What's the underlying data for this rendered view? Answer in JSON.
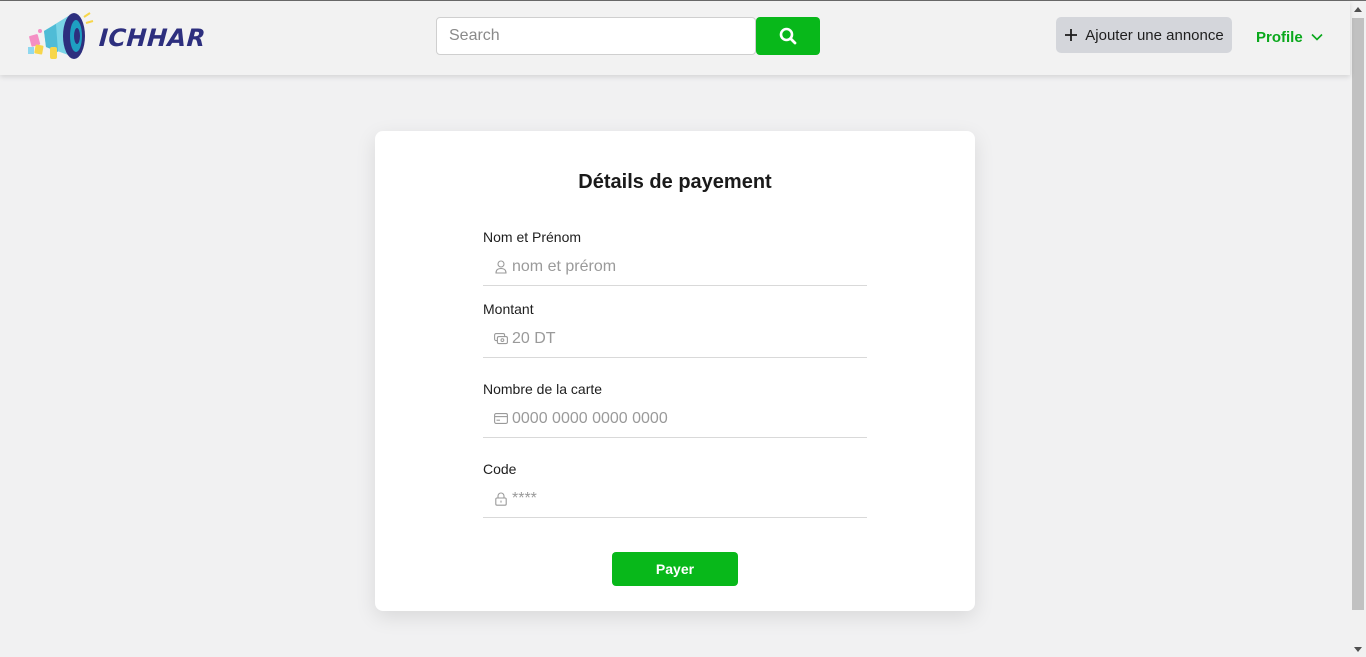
{
  "header": {
    "logo_text": "ICHHAR",
    "search": {
      "placeholder": "Search",
      "value": ""
    },
    "add_listing_label": "Ajouter une annonce",
    "profile_label": "Profile"
  },
  "payment": {
    "title": "Détails de payement",
    "fields": [
      {
        "label": "Nom et Prénom",
        "placeholder": "nom et prérom",
        "icon": "user-icon"
      },
      {
        "label": "Montant",
        "placeholder": "20 DT",
        "icon": "money-icon"
      },
      {
        "label": "Nombre de la carte",
        "placeholder": "0000 0000 0000 0000",
        "icon": "credit-card-icon"
      },
      {
        "label": "Code",
        "placeholder": "****",
        "icon": "lock-icon"
      }
    ],
    "submit_label": "Payer"
  },
  "colors": {
    "accent_green": "#08b81a",
    "logo_text": "#2d2f7e",
    "page_bg": "#f1f1f2"
  }
}
